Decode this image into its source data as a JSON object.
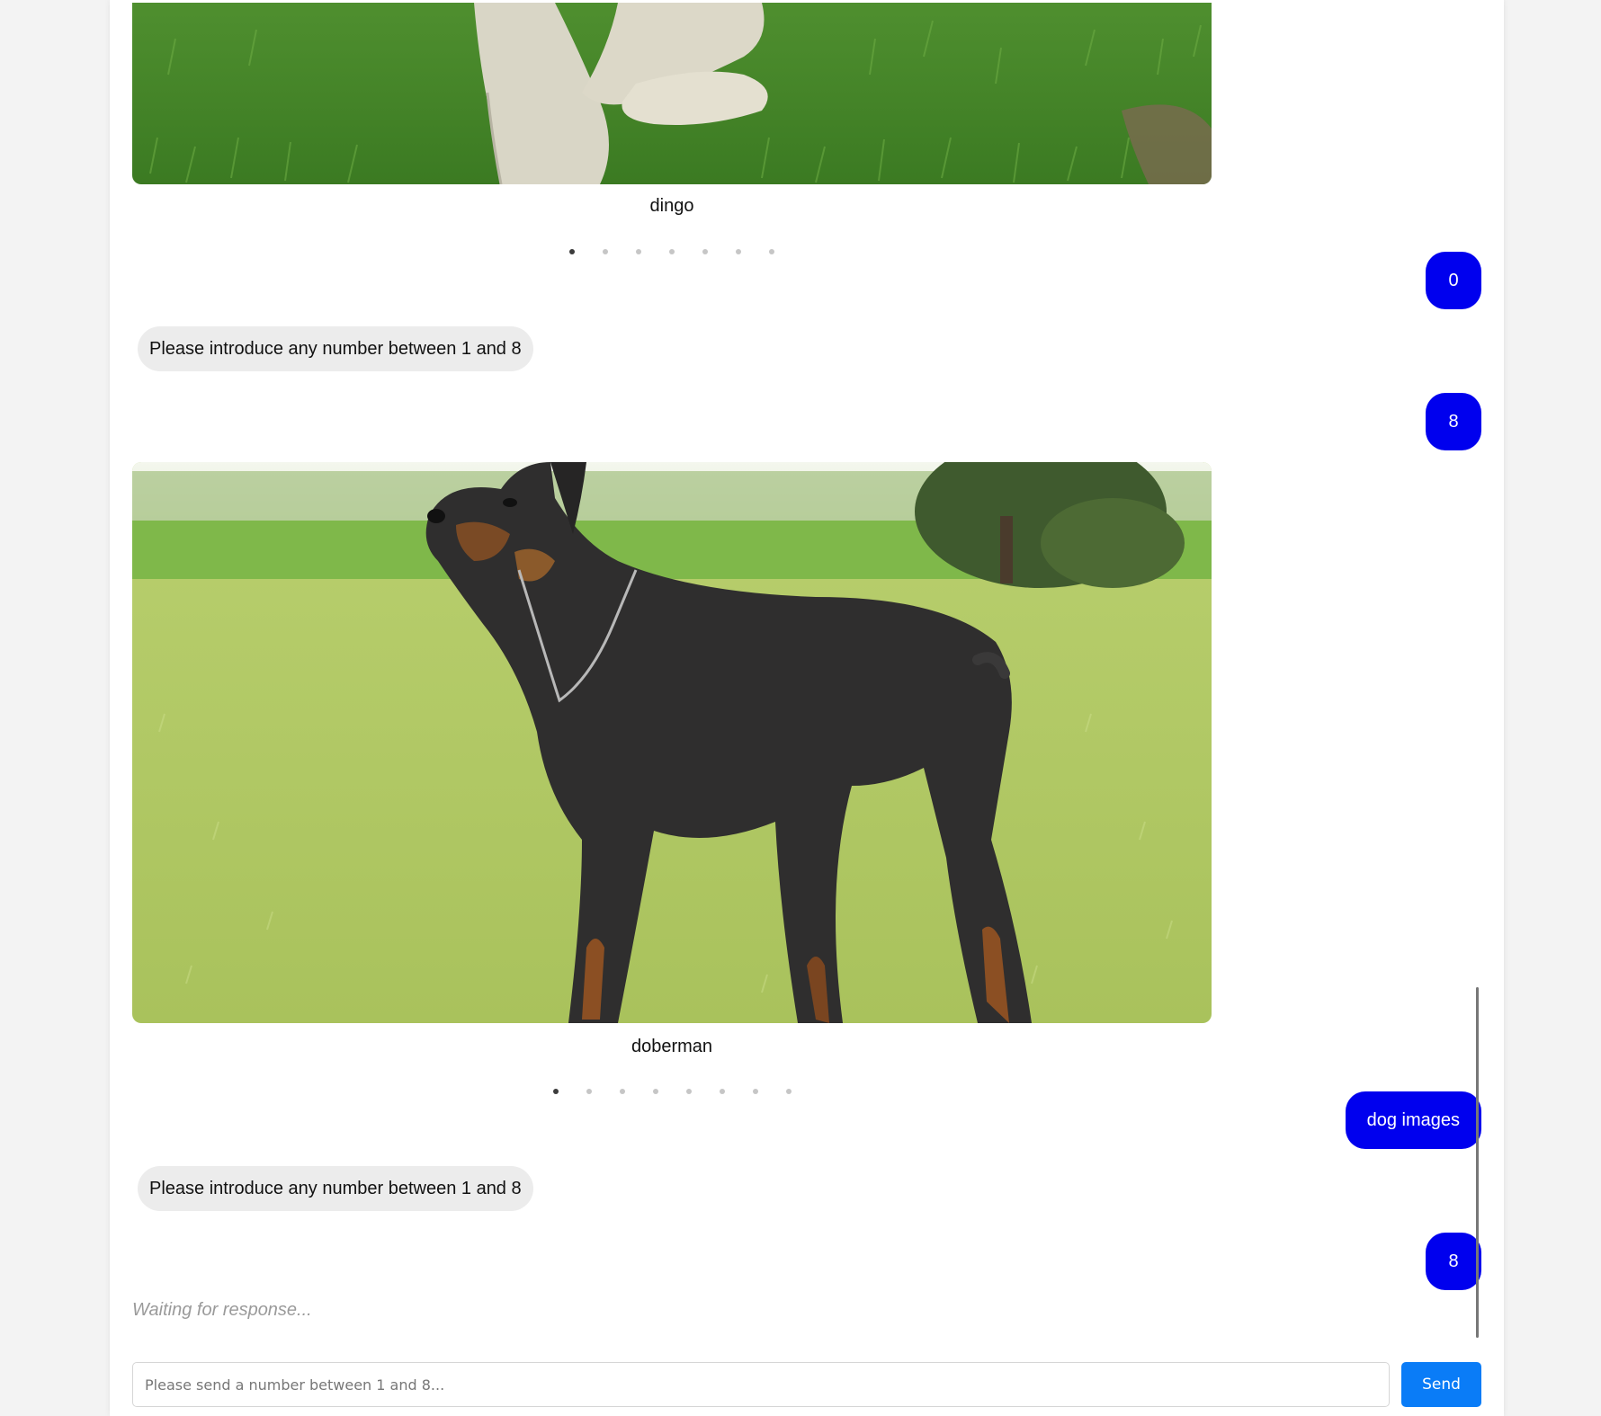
{
  "messages": [
    {
      "type": "image",
      "caption": "dingo",
      "dot_count": 7,
      "active_dot": 0
    },
    {
      "type": "user",
      "text": "0"
    },
    {
      "type": "bot",
      "text": "Please introduce any number between 1 and 8"
    },
    {
      "type": "user",
      "text": "8"
    },
    {
      "type": "image",
      "caption": "doberman",
      "dot_count": 8,
      "active_dot": 0
    },
    {
      "type": "user",
      "text": "dog images"
    },
    {
      "type": "bot",
      "text": "Please introduce any number between 1 and 8"
    },
    {
      "type": "user",
      "text": "8"
    }
  ],
  "status": {
    "waiting_text": "Waiting for response..."
  },
  "composer": {
    "placeholder": "Please send a number between 1 and 8...",
    "value": "",
    "send_label": "Send"
  },
  "colors": {
    "user_bubble": "#0000ee",
    "bot_bubble": "#ececec",
    "send_button": "#0a7cf7",
    "page_background": "#f3f3f3"
  }
}
